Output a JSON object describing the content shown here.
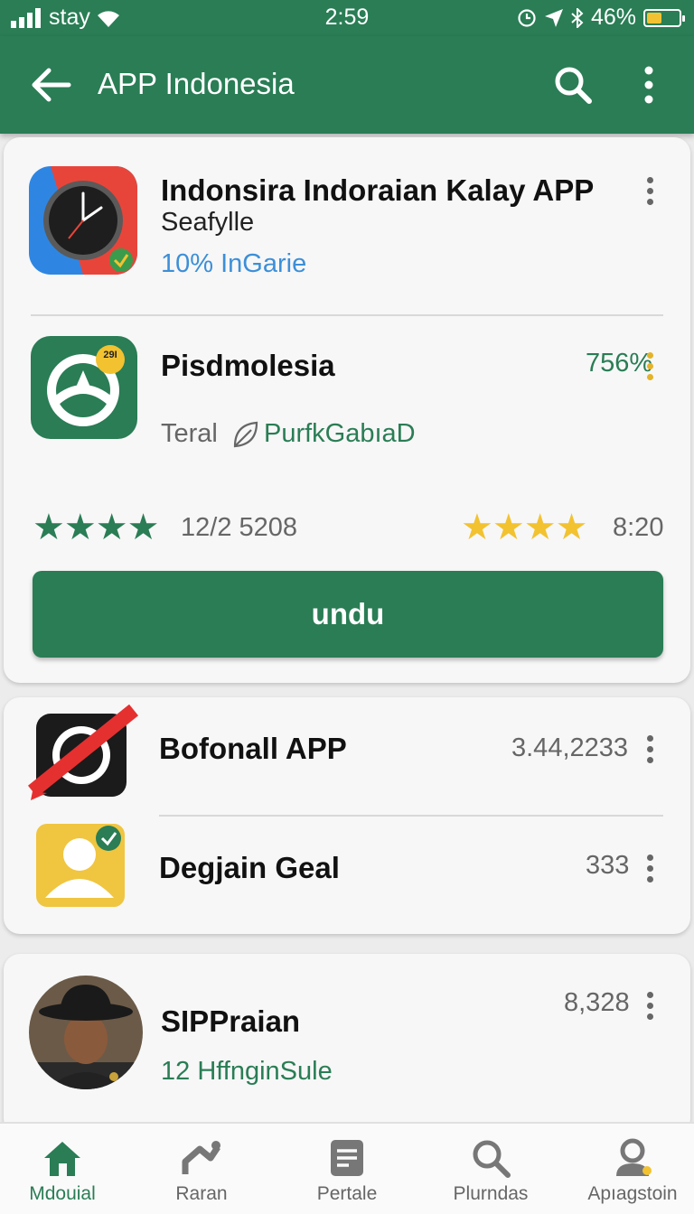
{
  "status_bar": {
    "carrier": "stay",
    "time": "2:59",
    "battery": "46%",
    "battery_level": 0.46
  },
  "app_bar": {
    "title": "APP Indonesia"
  },
  "featured": {
    "app1": {
      "title": "Indonsira Indoraian Kalay APP",
      "subtitle": "Seafylle",
      "meta": "10% InGarie"
    },
    "app2": {
      "title": "Pisdmolesia",
      "badge": "29I",
      "percent": "756%",
      "sub_label": "Teral",
      "developer": "PurfkGabıaD"
    },
    "ratings": {
      "left_rating": 4,
      "left_value": "12/2 5208",
      "right_rating": 4,
      "right_value": "8:20"
    },
    "download_label": "undu"
  },
  "list": [
    {
      "title": "Bofonall APP",
      "value": "3.44,2233"
    },
    {
      "title": "Degjain Geal",
      "value": "333"
    }
  ],
  "profile": {
    "title": "SIPPraian",
    "subtitle": "12 HffnginSule",
    "value": "8,328"
  },
  "bottom_nav": [
    {
      "label": "Mdouial",
      "icon": "home-icon",
      "active": true
    },
    {
      "label": "Raran",
      "icon": "chart-icon",
      "active": false
    },
    {
      "label": "Pertale",
      "icon": "document-icon",
      "active": false
    },
    {
      "label": "Plurndas",
      "icon": "search-icon",
      "active": false
    },
    {
      "label": "Apıagstoin",
      "icon": "account-icon",
      "active": false
    }
  ],
  "colors": {
    "primary": "#2a7d55",
    "star_green": "#2a7d55",
    "star_gold": "#f2c230",
    "link_blue": "#3c8fd8"
  }
}
